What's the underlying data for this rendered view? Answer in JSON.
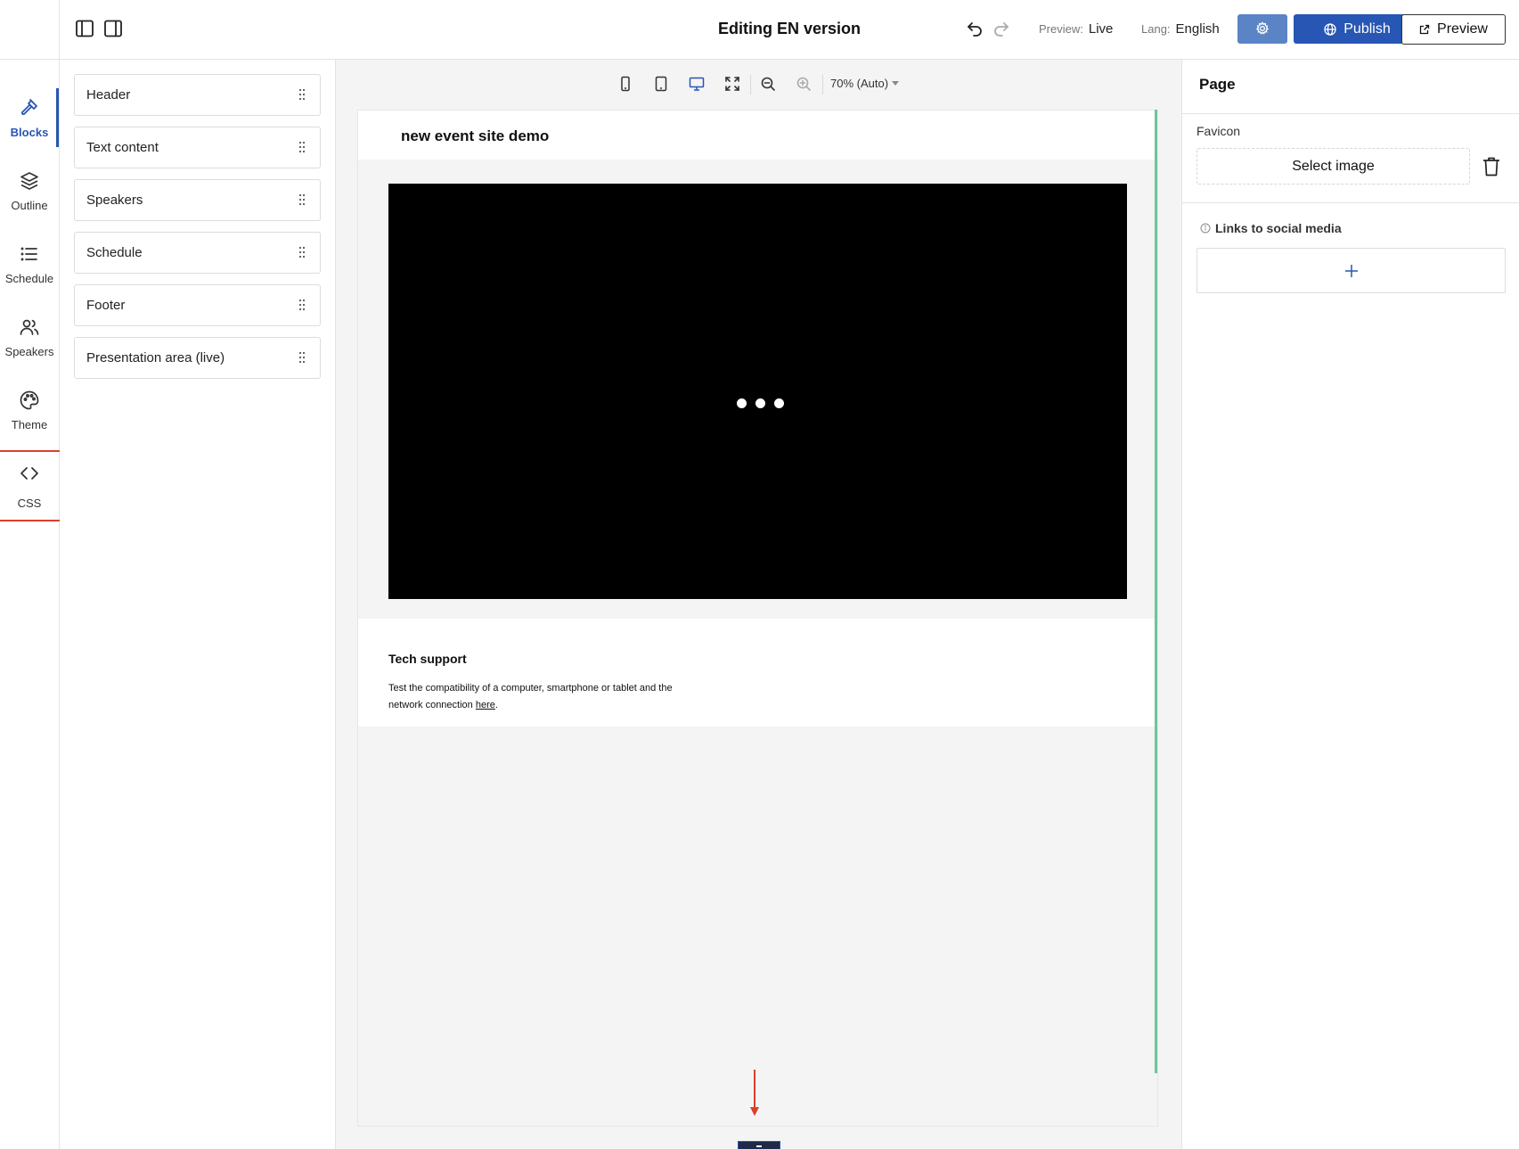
{
  "topbar": {
    "title": "Editing EN version",
    "preview_key": "Preview:",
    "preview_value": "Live",
    "lang_key": "Lang:",
    "lang_value": "English",
    "publish_label": "Publish",
    "preview_button_label": "Preview"
  },
  "rail": {
    "items": [
      {
        "label": "Blocks",
        "icon": "hammer-icon",
        "active": true
      },
      {
        "label": "Outline",
        "icon": "layers-icon"
      },
      {
        "label": "Schedule",
        "icon": "list-icon"
      },
      {
        "label": "Speakers",
        "icon": "users-icon"
      },
      {
        "label": "Theme",
        "icon": "palette-icon"
      },
      {
        "label": "CSS",
        "icon": "code-icon",
        "highlighted": true
      }
    ]
  },
  "blocks": {
    "items": [
      "Header",
      "Text content",
      "Speakers",
      "Schedule",
      "Footer",
      "Presentation area (live)"
    ]
  },
  "canvas": {
    "zoom_label": "70% (Auto)",
    "site_title": "new event site demo",
    "tech_title": "Tech support",
    "tech_text_before": "Test the compatibility of a computer, smartphone or tablet and the network connection ",
    "tech_link": "here",
    "tech_text_after": "."
  },
  "right_panel": {
    "title": "Page",
    "favicon_label": "Favicon",
    "select_image_label": "Select image",
    "social_label": "Links to social media"
  },
  "colors": {
    "accent": "#2756b4",
    "highlight": "#d9412a",
    "scroll_indicator": "#6ec59a"
  }
}
